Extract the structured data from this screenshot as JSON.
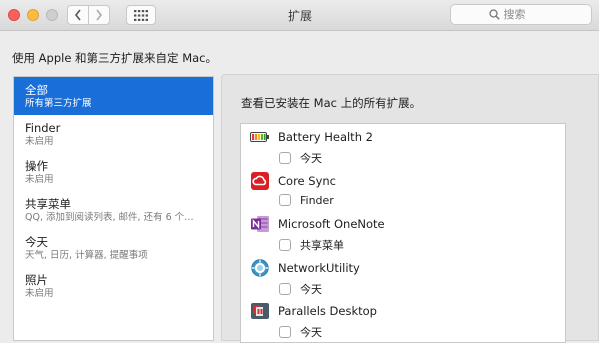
{
  "window": {
    "title": "扩展",
    "search_placeholder": "搜索"
  },
  "description": "使用 Apple 和第三方扩展来自定 Mac。",
  "sidebar": {
    "items": [
      {
        "title": "全部",
        "subtitle": "所有第三方扩展",
        "selected": true
      },
      {
        "title": "Finder",
        "subtitle": "未启用"
      },
      {
        "title": "操作",
        "subtitle": "未启用"
      },
      {
        "title": "共享菜单",
        "subtitle": "QQ, 添加到阅读列表, 邮件, 还有 6 个…"
      },
      {
        "title": "今天",
        "subtitle": "天气, 日历, 计算器, 提醒事项"
      },
      {
        "title": "照片",
        "subtitle": "未启用"
      }
    ]
  },
  "panel": {
    "heading": "查看已安装在 Mac 上的所有扩展。",
    "extensions": [
      {
        "name": "Battery Health 2",
        "option": "今天",
        "icon": "battery-icon"
      },
      {
        "name": "Core Sync",
        "option": "Finder",
        "icon": "creative-cloud-icon"
      },
      {
        "name": "Microsoft OneNote",
        "option": "共享菜单",
        "icon": "onenote-icon"
      },
      {
        "name": "NetworkUtility",
        "option": "今天",
        "icon": "network-utility-icon"
      },
      {
        "name": "Parallels Desktop",
        "option": "今天",
        "icon": "parallels-icon"
      }
    ]
  },
  "colors": {
    "selection": "#1a6ed8",
    "close": "#fc605c",
    "minimize": "#fdbc40"
  }
}
